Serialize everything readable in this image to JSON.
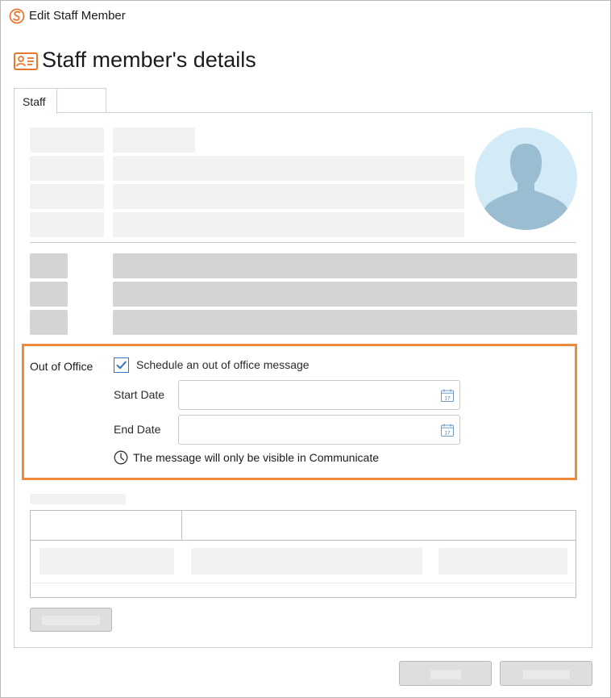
{
  "window": {
    "title": "Edit Staff Member",
    "icon": "app-logo-icon"
  },
  "header": {
    "title": "Staff member's details",
    "icon": "id-card-icon"
  },
  "tabs": [
    {
      "label": "Staff",
      "active": true
    },
    {
      "label": "",
      "active": false
    }
  ],
  "out_of_office": {
    "section_label": "Out of Office",
    "checkbox_label": "Schedule an out of office message",
    "checked": true,
    "start_date_label": "Start Date",
    "start_date_value": "",
    "end_date_label": "End Date",
    "end_date_value": "",
    "note": "The message will only be visible in Communicate",
    "note_icon": "clock-icon",
    "calendar_day": "17"
  },
  "colors": {
    "accent": "#ef8a3c",
    "checkbox_blue": "#2f75c2",
    "avatar_bg": "#d3ebf7",
    "avatar_silhouette": "#9bbdd1"
  }
}
